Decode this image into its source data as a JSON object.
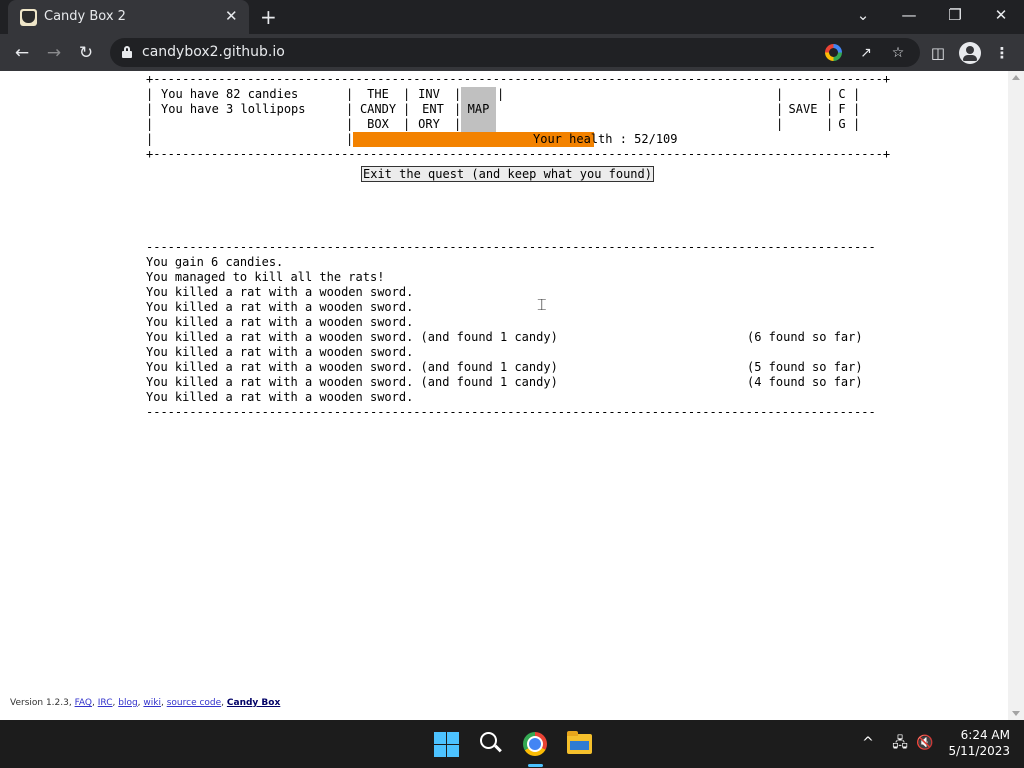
{
  "browser": {
    "tab_title": "Candy Box 2",
    "tab_close": "✕",
    "new_tab": "+",
    "url": "candybox2.github.io",
    "window_controls": {
      "tab_search": "⌄",
      "minimize": "—",
      "restore": "❐",
      "close": "✕"
    },
    "icons": [
      "back-arrow-icon",
      "forward-arrow-icon",
      "reload-icon",
      "lock-icon",
      "google-icon",
      "share-icon",
      "bookmark-star-icon",
      "side-panel-icon",
      "profile-icon",
      "menu-kebab-icon"
    ]
  },
  "game": {
    "candies_text": "You have 82 candies",
    "lollipops_text": "You have 3 lollipops",
    "tabs": {
      "candy_box": [
        "THE",
        "CANDY",
        "BOX"
      ],
      "inventory": [
        "INV",
        "ENT",
        "ORY"
      ],
      "map": "MAP",
      "save": "SAVE",
      "cfg": [
        "C",
        "F",
        "G"
      ]
    },
    "health_text": "Your health : 52/109",
    "health_current": 52,
    "health_max": 109,
    "exit_button": "Exit the quest (and keep what you found)",
    "log": [
      {
        "text": "You gain 6 candies.",
        "right": ""
      },
      {
        "text": "You managed to kill all the rats!",
        "right": ""
      },
      {
        "text": "You killed a rat with a wooden sword.",
        "right": ""
      },
      {
        "text": "You killed a rat with a wooden sword.",
        "right": ""
      },
      {
        "text": "You killed a rat with a wooden sword.",
        "right": ""
      },
      {
        "text": "You killed a rat with a wooden sword. (and found 1 candy)",
        "right": "(6 found so far)"
      },
      {
        "text": "You killed a rat with a wooden sword.",
        "right": ""
      },
      {
        "text": "You killed a rat with a wooden sword. (and found 1 candy)",
        "right": "(5 found so far)"
      },
      {
        "text": "You killed a rat with a wooden sword. (and found 1 candy)",
        "right": "(4 found so far)"
      },
      {
        "text": "You killed a rat with a wooden sword.",
        "right": ""
      }
    ]
  },
  "footer": {
    "version": "Version 1.2.3, ",
    "links": [
      "FAQ",
      "IRC",
      "blog",
      "wiki",
      "source code",
      "Candy Box"
    ]
  },
  "taskbar": {
    "apps": [
      "windows-start-icon",
      "search-icon",
      "chrome-icon",
      "file-explorer-icon"
    ],
    "tray": {
      "chevron": "^",
      "network": "🖧",
      "volume": "🔇"
    },
    "time": "6:24 AM",
    "date": "5/11/2023"
  }
}
